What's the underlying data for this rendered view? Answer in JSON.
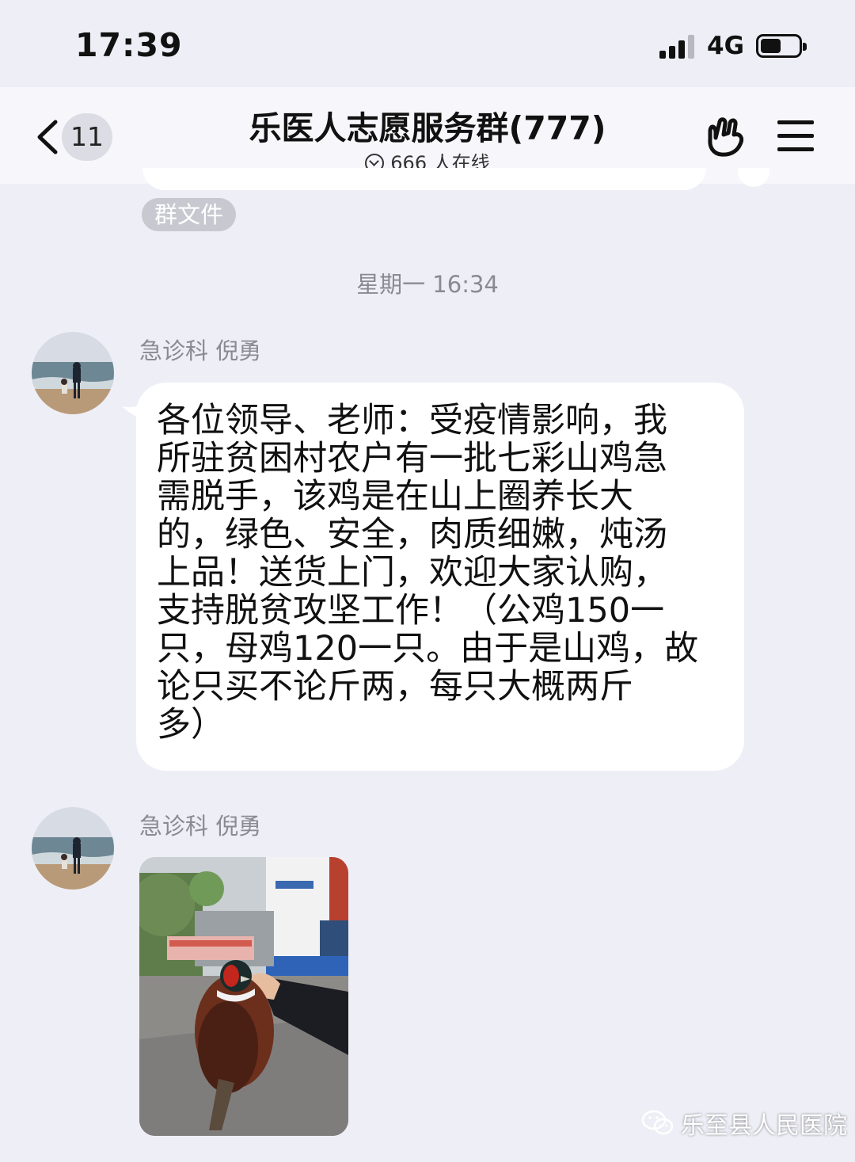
{
  "status_bar": {
    "time": "17:39",
    "network": "4G",
    "battery_level": 0.55
  },
  "header": {
    "unread_count": "11",
    "title": "乐医人志愿服务群(777)",
    "online_status": "666 人在线"
  },
  "chips": {
    "group_files": "群文件"
  },
  "chat": {
    "timestamp": "星期一 16:34",
    "messages": [
      {
        "sender": "急诊科 倪勇",
        "type": "text",
        "text": "各位领导、老师：受疫情影响，我\n所驻贫困村农户有一批七彩山鸡急\n需脱手，该鸡是在山上圈养长大\n的，绿色、安全，肉质细嫩，炖汤\n上品！送货上门，欢迎大家认购，\n支持脱贫攻坚工作！（公鸡150一\n只，母鸡120一只。由于是山鸡，故\n论只买不论斤两，每只大概两斤\n多）"
      },
      {
        "sender": "急诊科 倪勇",
        "type": "image",
        "image_icon": "pheasant-photo"
      }
    ]
  },
  "watermark": {
    "text": "乐至县人民医院",
    "icon": "wechat-icon"
  }
}
